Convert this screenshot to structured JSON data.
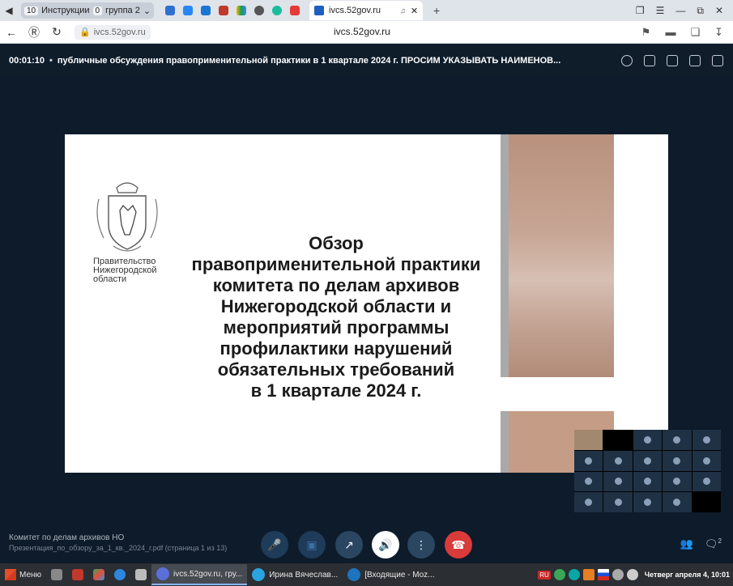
{
  "browser": {
    "tab_group": {
      "count": "10",
      "label": "Инструкции"
    },
    "tab_group2": {
      "count": "0",
      "label": "группа 2"
    },
    "active_tab": {
      "title": "ivcs.52gov.ru"
    },
    "url_pill": "ivcs.52gov.ru",
    "url_center": "ivcs.52gov.ru"
  },
  "conference": {
    "elapsed": "00:01:10",
    "separator": "•",
    "title": "публичные обсуждения правоприменительной практики в 1 квартале 2024 г. ПРОСИМ УКАЗЫВАТЬ НАИМЕНОВ...",
    "organizer": "Комитет по делам архивов НО",
    "shared_file": "Презентация_по_обзору_за_1_кв._2024_г.pdf (страница 1 из 13)",
    "chat_badge": "2"
  },
  "slide": {
    "logo_text": [
      "Правительство",
      "Нижегородской",
      "области"
    ],
    "title_lines": [
      "Обзор",
      "правоприменительной практики",
      "комитета по делам архивов",
      "Нижегородской области и",
      "мероприятий программы",
      "профилактики нарушений",
      "обязательных требований",
      "в 1 квартале 2024 г."
    ]
  },
  "taskbar": {
    "menu_label": "Меню",
    "tasks": [
      {
        "label": "ivcs.52gov.ru, гру..."
      },
      {
        "label": "Ирина Вячеслав..."
      },
      {
        "label": "[Входящие - Moz..."
      }
    ],
    "lang": "RU",
    "clock": "Четверг апреля  4, 10:01"
  },
  "colors": {
    "accent": "#1f73c8",
    "end_call": "#d93a3a",
    "background": "#0d1b2a"
  }
}
